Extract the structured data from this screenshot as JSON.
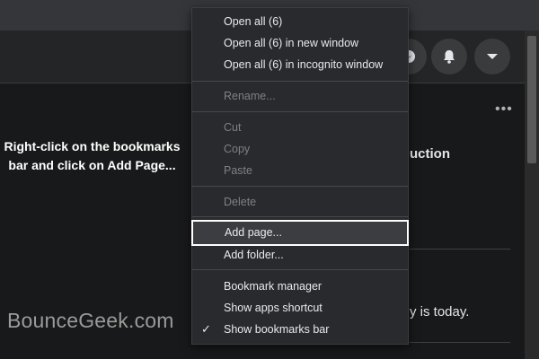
{
  "instruction": {
    "text": "Right-click on the bookmarks bar and click on Add Page..."
  },
  "watermark": {
    "text": "BounceGeek.com"
  },
  "background_post": {
    "title_fragment": "uction",
    "text_fragment": "y is today.",
    "more_symbol": "•••"
  },
  "context_menu": {
    "open_all": "Open all (6)",
    "open_all_new_window": "Open all (6) in new window",
    "open_all_incognito": "Open all (6) in incognito window",
    "rename": "Rename...",
    "cut": "Cut",
    "copy": "Copy",
    "paste": "Paste",
    "delete": "Delete",
    "add_page": "Add page...",
    "add_folder": "Add folder...",
    "bookmark_manager": "Bookmark manager",
    "show_apps_shortcut": "Show apps shortcut",
    "show_bookmarks_bar": "Show bookmarks bar",
    "checkmark": "✓"
  },
  "colors": {
    "page_bg": "#18191a",
    "menu_bg": "#292a2d",
    "highlight_bg": "#3c3d40",
    "disabled_text": "#7e8084"
  },
  "icons": [
    "messenger-icon",
    "notifications-bell-icon",
    "account-menu-caret-icon",
    "more-options-icon",
    "checkmark-icon"
  ]
}
